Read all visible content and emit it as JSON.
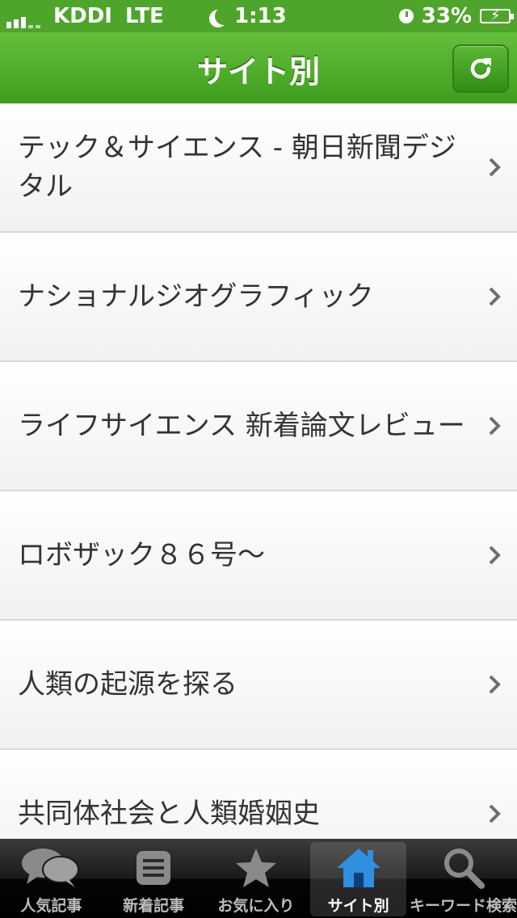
{
  "status_bar": {
    "carrier": "KDDI",
    "network": "LTE",
    "time": "1:13",
    "battery": "33%"
  },
  "nav": {
    "title": "サイト別",
    "refresh_icon": "refresh-icon"
  },
  "list": {
    "items": [
      {
        "label": "テック＆サイエンス - 朝日新聞デジタル"
      },
      {
        "label": "ナショナルジオグラフィック"
      },
      {
        "label": "ライフサイエンス 新着論文レビュー"
      },
      {
        "label": "ロボザック８６号～"
      },
      {
        "label": "人類の起源を探る"
      },
      {
        "label": "共同体社会と人類婚姻史"
      }
    ]
  },
  "tabbar": {
    "tabs": [
      {
        "label": "人気記事",
        "icon": "speech-bubbles-icon"
      },
      {
        "label": "新着記事",
        "icon": "list-icon"
      },
      {
        "label": "お気に入り",
        "icon": "star-icon"
      },
      {
        "label": "サイト別",
        "icon": "home-icon"
      },
      {
        "label": "キーワード検索",
        "icon": "search-icon"
      }
    ],
    "active_index": 3
  },
  "colors": {
    "nav_green": "#4fa52b",
    "active_tab_icon": "#2f8fe0"
  }
}
